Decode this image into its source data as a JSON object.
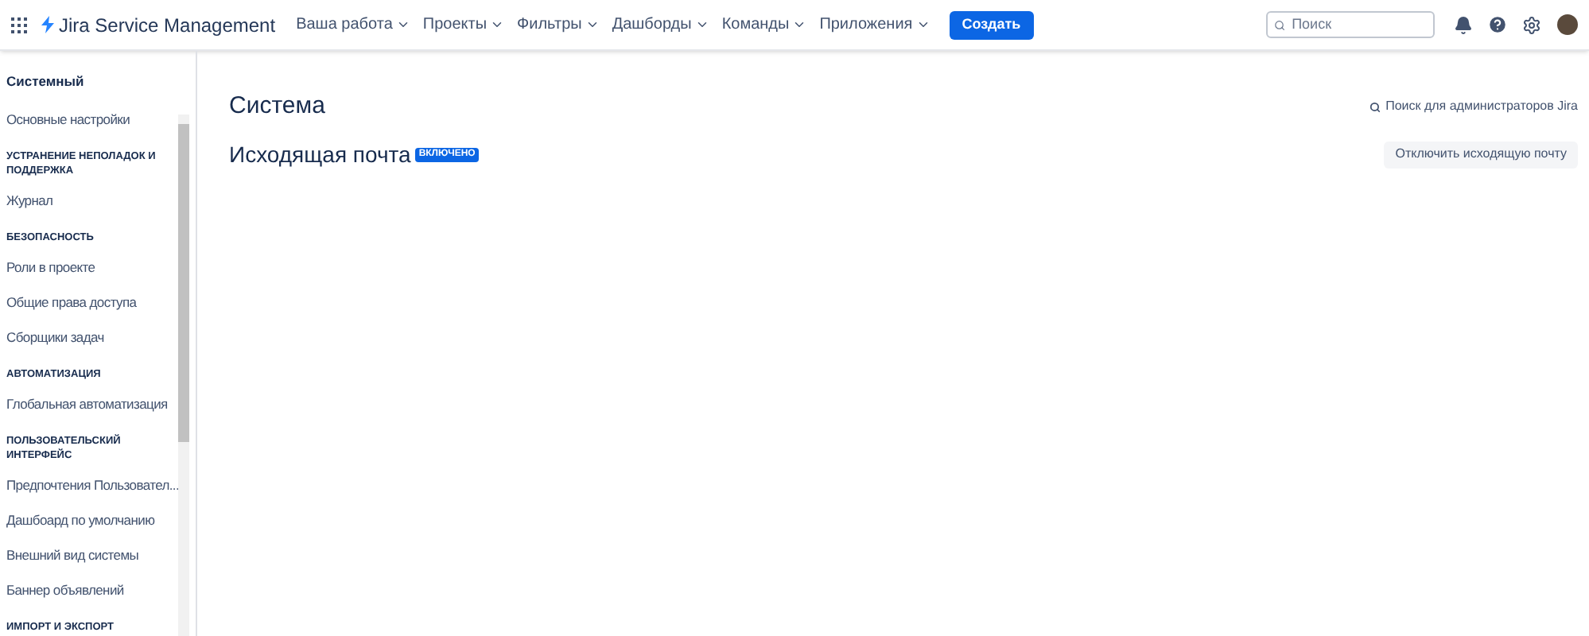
{
  "header": {
    "product": "Jira Service Management",
    "nav": [
      {
        "label": "Ваша работа"
      },
      {
        "label": "Проекты"
      },
      {
        "label": "Фильтры"
      },
      {
        "label": "Дашборды"
      },
      {
        "label": "Команды"
      },
      {
        "label": "Приложения"
      }
    ],
    "create": "Создать",
    "search": {
      "placeholder": "Поиск"
    }
  },
  "sidebar": {
    "items": [
      {
        "kind": "title",
        "label": "Системный"
      },
      {
        "kind": "link",
        "label": "Основные настройки"
      },
      {
        "kind": "heading",
        "label": "УСТРАНЕНИЕ НЕПОЛАДОК И ПОДДЕРЖКА"
      },
      {
        "kind": "link",
        "label": "Журнал"
      },
      {
        "kind": "heading",
        "label": "БЕЗОПАСНОСТЬ"
      },
      {
        "kind": "link",
        "label": "Роли в проекте"
      },
      {
        "kind": "link",
        "label": "Общие права доступа"
      },
      {
        "kind": "link",
        "label": "Сборщики задач"
      },
      {
        "kind": "heading",
        "label": "АВТОМАТИЗАЦИЯ"
      },
      {
        "kind": "link",
        "label": "Глобальная автоматизация"
      },
      {
        "kind": "heading",
        "label": "ПОЛЬЗОВАТЕЛЬСКИЙ ИНТЕРФЕЙС"
      },
      {
        "kind": "link",
        "label": "Предпочтения Пользовател..."
      },
      {
        "kind": "link",
        "label": "Дашбоард по умолчанию"
      },
      {
        "kind": "link",
        "label": "Внешний вид системы"
      },
      {
        "kind": "link",
        "label": "Баннер объявлений"
      },
      {
        "kind": "heading",
        "label": "ИМПОРТ И ЭКСПОРТ"
      }
    ]
  },
  "main": {
    "title": "Система",
    "admin_search": "Поиск для администраторов Jira",
    "section": {
      "title": "Исходящая почта",
      "status": "ВКЛЮЧЕНО",
      "on": true
    },
    "toggle_button": "Отключить исходящую почту"
  }
}
